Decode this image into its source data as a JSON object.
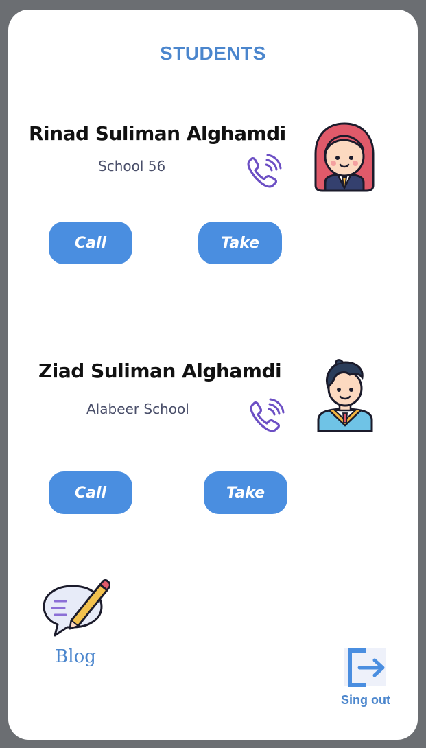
{
  "page": {
    "title": "STUDENTS"
  },
  "students": [
    {
      "name": "Rinad Suliman Alghamdi",
      "school": "School 56",
      "call_label": "Call",
      "take_label": "Take",
      "avatar_icon": "girl-student-avatar",
      "phone_icon": "phone-ringing-icon"
    },
    {
      "name": "Ziad Suliman Alghamdi",
      "school": "Alabeer School",
      "call_label": "Call",
      "take_label": "Take",
      "avatar_icon": "boy-student-avatar",
      "phone_icon": "phone-ringing-icon"
    }
  ],
  "footer": {
    "blog_label": "Blog",
    "signout_label": "Sing out"
  },
  "colors": {
    "accent": "#4a8ee0",
    "title": "#4b86cd",
    "phone": "#6c4fc4",
    "frame": "#6b6e72"
  }
}
